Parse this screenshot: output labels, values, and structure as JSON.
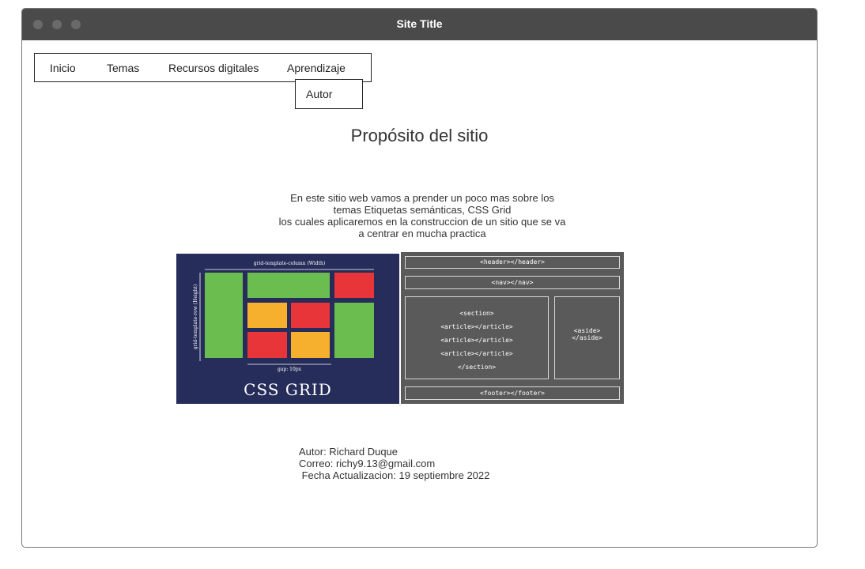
{
  "window": {
    "title": "Site Title"
  },
  "nav": {
    "items": [
      {
        "label": "Inicio"
      },
      {
        "label": "Temas"
      },
      {
        "label": "Recursos digitales"
      },
      {
        "label": "Aprendizaje"
      }
    ],
    "dropdown": {
      "items": [
        {
          "label": "Autor"
        }
      ]
    }
  },
  "main": {
    "title": "Propósito del sitio",
    "description_lines": [
      "En este sitio web vamos a prender un poco mas sobre los",
      "temas Etiquetas semánticas, CSS Grid",
      "los cuales aplicaremos en la construccion de un sitio que se va",
      "a centrar en mucha practica"
    ]
  },
  "css_grid_image": {
    "title": "CSS GRID",
    "column_label": "grid-template-column (Width)",
    "row_label": "grid-template-row (Height)",
    "gap_label": "gap: 10px",
    "colors": {
      "background": "#272d5a",
      "green": "#6cbd4f",
      "red": "#e8353a",
      "orange": "#f7b02e"
    }
  },
  "semantic_image": {
    "header": "<header></header>",
    "nav": "<nav></nav>",
    "section_open": "<section>",
    "article_1": "<article></article>",
    "article_2": "<article></article>",
    "article_3": "<article></article>",
    "section_close": "</section>",
    "aside_open": "<aside>",
    "aside_close": "</aside>",
    "footer": "<footer></footer>"
  },
  "footer_info": {
    "author": "Autor: Richard Duque",
    "email": "Correo: richy9.13@gmail.com",
    "updated": " Fecha Actualizacion: 19 septiembre 2022"
  }
}
